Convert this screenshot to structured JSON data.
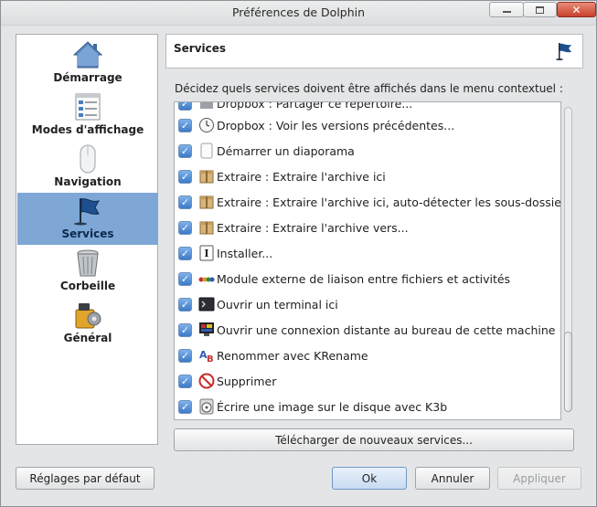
{
  "window": {
    "title": "Préférences de Dolphin"
  },
  "sidebar": {
    "items": [
      {
        "label": "Démarrage",
        "icon": "home-icon"
      },
      {
        "label": "Modes d'affichage",
        "icon": "view-modes-icon"
      },
      {
        "label": "Navigation",
        "icon": "mouse-icon"
      },
      {
        "label": "Services",
        "icon": "flag-icon",
        "active": true
      },
      {
        "label": "Corbeille",
        "icon": "trash-icon"
      },
      {
        "label": "Général",
        "icon": "settings-icon"
      }
    ]
  },
  "header": {
    "title": "Services",
    "icon": "flag-icon"
  },
  "description": "Décidez quels services doivent être affichés dans le menu contextuel :",
  "services": [
    {
      "label": "Dropbox : Partager ce répertoire...",
      "icon": "dropbox-icon",
      "checked": true
    },
    {
      "label": "Dropbox : Voir les versions précédentes...",
      "icon": "clock-icon",
      "checked": true
    },
    {
      "label": "Démarrer un diaporama",
      "icon": "slideshow-icon",
      "checked": true
    },
    {
      "label": "Extraire : Extraire l'archive ici",
      "icon": "archive-icon",
      "checked": true
    },
    {
      "label": "Extraire : Extraire l'archive ici, auto-détecter les sous-dossiers",
      "icon": "archive-icon",
      "checked": true
    },
    {
      "label": "Extraire : Extraire l'archive vers...",
      "icon": "archive-icon",
      "checked": true
    },
    {
      "label": "Installer...",
      "icon": "install-icon",
      "checked": true
    },
    {
      "label": "Module externe de liaison entre fichiers et activités",
      "icon": "activities-icon",
      "checked": true
    },
    {
      "label": "Ouvrir un terminal ici",
      "icon": "terminal-icon",
      "checked": true
    },
    {
      "label": "Ouvrir une connexion distante au bureau de cette machine",
      "icon": "remote-desktop-icon",
      "checked": true
    },
    {
      "label": "Renommer avec KRename",
      "icon": "krename-icon",
      "checked": true
    },
    {
      "label": "Supprimer",
      "icon": "delete-icon",
      "checked": true
    },
    {
      "label": "Écrire une image sur le disque avec K3b",
      "icon": "disc-icon",
      "checked": true
    }
  ],
  "buttons": {
    "download": "Télécharger de nouveaux services...",
    "defaults": "Réglages par défaut",
    "ok": "Ok",
    "cancel": "Annuler",
    "apply": "Appliquer"
  },
  "colors": {
    "accent": "#7ea7d6",
    "checkbox": "#3c7ac7"
  }
}
